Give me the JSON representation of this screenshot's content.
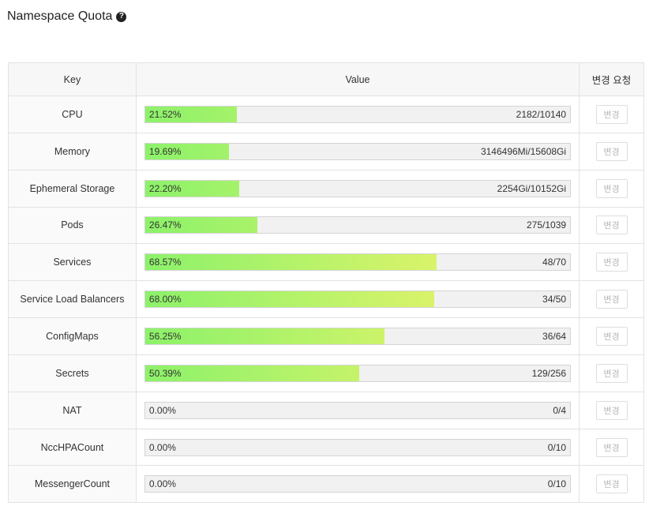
{
  "page": {
    "title": "Namespace Quota",
    "help_icon": "question-circle"
  },
  "table": {
    "headers": {
      "key": "Key",
      "value": "Value",
      "action": "변경 요청"
    },
    "rows": [
      {
        "key": "CPU",
        "percent_label": "21.52%",
        "fill": 0.2152,
        "usage": "2182/10140",
        "button": "변경"
      },
      {
        "key": "Memory",
        "percent_label": "19.69%",
        "fill": 0.1969,
        "usage": "3146496Mi/15608Gi",
        "button": "변경"
      },
      {
        "key": "Ephemeral Storage",
        "percent_label": "22.20%",
        "fill": 0.222,
        "usage": "2254Gi/10152Gi",
        "button": "변경"
      },
      {
        "key": "Pods",
        "percent_label": "26.47%",
        "fill": 0.2647,
        "usage": "275/1039",
        "button": "변경"
      },
      {
        "key": "Services",
        "percent_label": "68.57%",
        "fill": 0.6857,
        "usage": "48/70",
        "button": "변경"
      },
      {
        "key": "Service Load Balancers",
        "percent_label": "68.00%",
        "fill": 0.68,
        "usage": "34/50",
        "button": "변경"
      },
      {
        "key": "ConfigMaps",
        "percent_label": "56.25%",
        "fill": 0.5625,
        "usage": "36/64",
        "button": "변경"
      },
      {
        "key": "Secrets",
        "percent_label": "50.39%",
        "fill": 0.5039,
        "usage": "129/256",
        "button": "변경"
      },
      {
        "key": "NAT",
        "percent_label": "0.00%",
        "fill": 0,
        "usage": "0/4",
        "button": "변경"
      },
      {
        "key": "NccHPACount",
        "percent_label": "0.00%",
        "fill": 0,
        "usage": "0/10",
        "button": "변경"
      },
      {
        "key": "MessengerCount",
        "percent_label": "0.00%",
        "fill": 0,
        "usage": "0/10",
        "button": "변경"
      }
    ]
  },
  "colors": {
    "bar_start": "#8cf26a",
    "bar_end": "#fdf46a",
    "bar_track": "#f1f1f1"
  }
}
